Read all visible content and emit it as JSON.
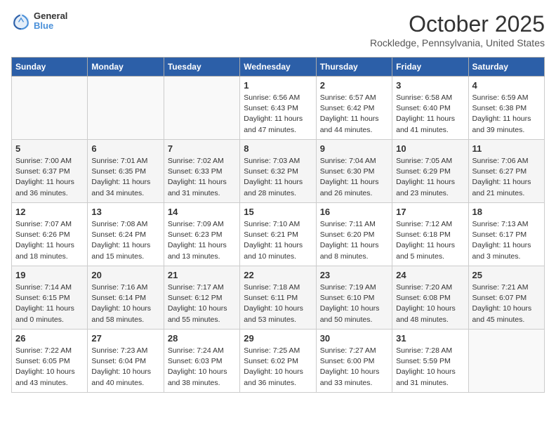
{
  "header": {
    "logo_line1": "General",
    "logo_line2": "Blue",
    "month": "October 2025",
    "location": "Rockledge, Pennsylvania, United States"
  },
  "days_of_week": [
    "Sunday",
    "Monday",
    "Tuesday",
    "Wednesday",
    "Thursday",
    "Friday",
    "Saturday"
  ],
  "weeks": [
    [
      {
        "day": "",
        "info": ""
      },
      {
        "day": "",
        "info": ""
      },
      {
        "day": "",
        "info": ""
      },
      {
        "day": "1",
        "info": "Sunrise: 6:56 AM\nSunset: 6:43 PM\nDaylight: 11 hours\nand 47 minutes."
      },
      {
        "day": "2",
        "info": "Sunrise: 6:57 AM\nSunset: 6:42 PM\nDaylight: 11 hours\nand 44 minutes."
      },
      {
        "day": "3",
        "info": "Sunrise: 6:58 AM\nSunset: 6:40 PM\nDaylight: 11 hours\nand 41 minutes."
      },
      {
        "day": "4",
        "info": "Sunrise: 6:59 AM\nSunset: 6:38 PM\nDaylight: 11 hours\nand 39 minutes."
      }
    ],
    [
      {
        "day": "5",
        "info": "Sunrise: 7:00 AM\nSunset: 6:37 PM\nDaylight: 11 hours\nand 36 minutes."
      },
      {
        "day": "6",
        "info": "Sunrise: 7:01 AM\nSunset: 6:35 PM\nDaylight: 11 hours\nand 34 minutes."
      },
      {
        "day": "7",
        "info": "Sunrise: 7:02 AM\nSunset: 6:33 PM\nDaylight: 11 hours\nand 31 minutes."
      },
      {
        "day": "8",
        "info": "Sunrise: 7:03 AM\nSunset: 6:32 PM\nDaylight: 11 hours\nand 28 minutes."
      },
      {
        "day": "9",
        "info": "Sunrise: 7:04 AM\nSunset: 6:30 PM\nDaylight: 11 hours\nand 26 minutes."
      },
      {
        "day": "10",
        "info": "Sunrise: 7:05 AM\nSunset: 6:29 PM\nDaylight: 11 hours\nand 23 minutes."
      },
      {
        "day": "11",
        "info": "Sunrise: 7:06 AM\nSunset: 6:27 PM\nDaylight: 11 hours\nand 21 minutes."
      }
    ],
    [
      {
        "day": "12",
        "info": "Sunrise: 7:07 AM\nSunset: 6:26 PM\nDaylight: 11 hours\nand 18 minutes."
      },
      {
        "day": "13",
        "info": "Sunrise: 7:08 AM\nSunset: 6:24 PM\nDaylight: 11 hours\nand 15 minutes."
      },
      {
        "day": "14",
        "info": "Sunrise: 7:09 AM\nSunset: 6:23 PM\nDaylight: 11 hours\nand 13 minutes."
      },
      {
        "day": "15",
        "info": "Sunrise: 7:10 AM\nSunset: 6:21 PM\nDaylight: 11 hours\nand 10 minutes."
      },
      {
        "day": "16",
        "info": "Sunrise: 7:11 AM\nSunset: 6:20 PM\nDaylight: 11 hours\nand 8 minutes."
      },
      {
        "day": "17",
        "info": "Sunrise: 7:12 AM\nSunset: 6:18 PM\nDaylight: 11 hours\nand 5 minutes."
      },
      {
        "day": "18",
        "info": "Sunrise: 7:13 AM\nSunset: 6:17 PM\nDaylight: 11 hours\nand 3 minutes."
      }
    ],
    [
      {
        "day": "19",
        "info": "Sunrise: 7:14 AM\nSunset: 6:15 PM\nDaylight: 11 hours\nand 0 minutes."
      },
      {
        "day": "20",
        "info": "Sunrise: 7:16 AM\nSunset: 6:14 PM\nDaylight: 10 hours\nand 58 minutes."
      },
      {
        "day": "21",
        "info": "Sunrise: 7:17 AM\nSunset: 6:12 PM\nDaylight: 10 hours\nand 55 minutes."
      },
      {
        "day": "22",
        "info": "Sunrise: 7:18 AM\nSunset: 6:11 PM\nDaylight: 10 hours\nand 53 minutes."
      },
      {
        "day": "23",
        "info": "Sunrise: 7:19 AM\nSunset: 6:10 PM\nDaylight: 10 hours\nand 50 minutes."
      },
      {
        "day": "24",
        "info": "Sunrise: 7:20 AM\nSunset: 6:08 PM\nDaylight: 10 hours\nand 48 minutes."
      },
      {
        "day": "25",
        "info": "Sunrise: 7:21 AM\nSunset: 6:07 PM\nDaylight: 10 hours\nand 45 minutes."
      }
    ],
    [
      {
        "day": "26",
        "info": "Sunrise: 7:22 AM\nSunset: 6:05 PM\nDaylight: 10 hours\nand 43 minutes."
      },
      {
        "day": "27",
        "info": "Sunrise: 7:23 AM\nSunset: 6:04 PM\nDaylight: 10 hours\nand 40 minutes."
      },
      {
        "day": "28",
        "info": "Sunrise: 7:24 AM\nSunset: 6:03 PM\nDaylight: 10 hours\nand 38 minutes."
      },
      {
        "day": "29",
        "info": "Sunrise: 7:25 AM\nSunset: 6:02 PM\nDaylight: 10 hours\nand 36 minutes."
      },
      {
        "day": "30",
        "info": "Sunrise: 7:27 AM\nSunset: 6:00 PM\nDaylight: 10 hours\nand 33 minutes."
      },
      {
        "day": "31",
        "info": "Sunrise: 7:28 AM\nSunset: 5:59 PM\nDaylight: 10 hours\nand 31 minutes."
      },
      {
        "day": "",
        "info": ""
      }
    ]
  ]
}
